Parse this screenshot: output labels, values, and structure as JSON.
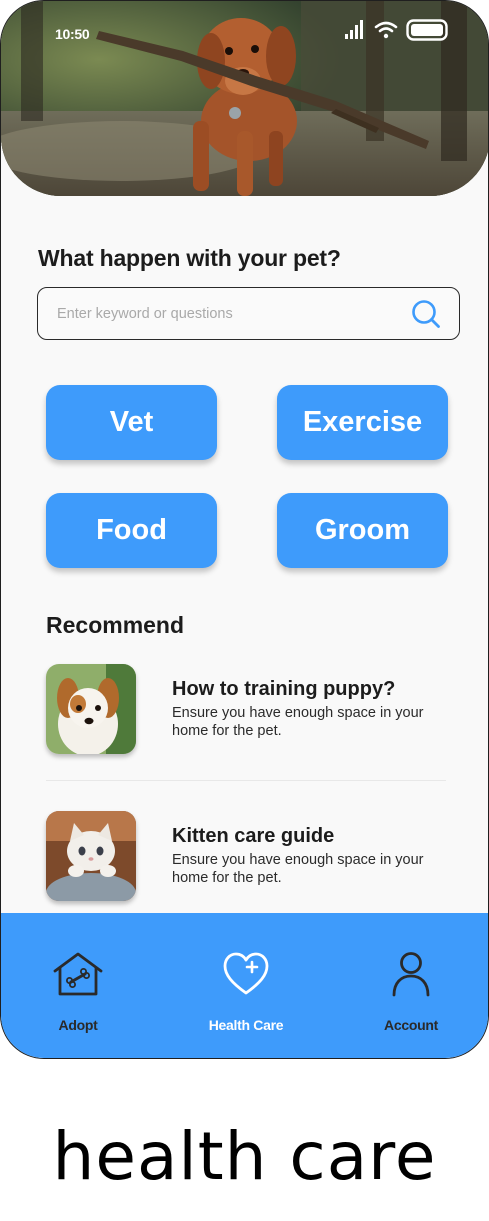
{
  "status_bar": {
    "time": "10:50"
  },
  "hero": {
    "image": "dog-with-stick-photo"
  },
  "question": "What happen with your pet?",
  "search": {
    "placeholder": "Enter keyword or questions",
    "value": "",
    "icon": "search-icon"
  },
  "categories": [
    {
      "label": "Vet"
    },
    {
      "label": "Exercise"
    },
    {
      "label": "Food"
    },
    {
      "label": "Groom"
    }
  ],
  "recommend": {
    "title": "Recommend",
    "items": [
      {
        "title": "How to training puppy?",
        "description": "Ensure you have enough space in your home for the pet.",
        "thumb": "puppy-photo"
      },
      {
        "title": "Kitten care guide",
        "description": "Ensure you have enough space in your home for the pet.",
        "thumb": "kitten-photo"
      }
    ]
  },
  "nav": {
    "items": [
      {
        "label": "Adopt",
        "icon": "house-bone-icon",
        "active": false
      },
      {
        "label": "Health Care",
        "icon": "heart-plus-icon",
        "active": true
      },
      {
        "label": "Account",
        "icon": "user-icon",
        "active": false
      }
    ]
  },
  "caption": "health care",
  "colors": {
    "accent": "#3e9bfb",
    "text": "#1c1c1c",
    "background": "#f9f9f9"
  }
}
